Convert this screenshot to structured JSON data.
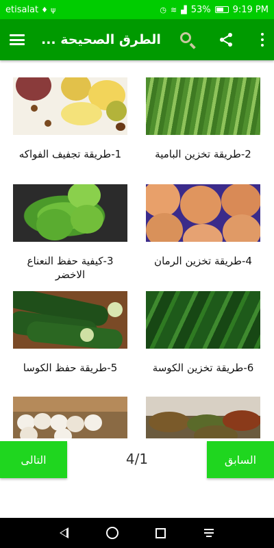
{
  "status_bar": {
    "carrier": "etisalat",
    "battery": "53%",
    "time": "9:19 PM"
  },
  "app_bar": {
    "title": "الطرق الصحيحة ...",
    "icons": [
      "menu-icon",
      "search-icon",
      "share-icon",
      "more-vert-icon"
    ]
  },
  "items": [
    {
      "caption": "2-طريقة تخزين البامية",
      "image": "okra"
    },
    {
      "caption": "1-طريقة تجفيف الفواكه",
      "image": "dried-fruit"
    },
    {
      "caption": "4-طريقة تخزين الرمان",
      "image": "pomegranate"
    },
    {
      "caption": "3-كيفية حفظ النعناع الاخضر",
      "image": "mint"
    },
    {
      "caption": "6-طريقة تخزين الكوسة",
      "image": "zucchini"
    },
    {
      "caption": "5-طريقة حفظ الكوسا",
      "image": "zucchini"
    },
    {
      "caption": "",
      "image": "spices"
    },
    {
      "caption": "",
      "image": "garlic"
    }
  ],
  "pager": {
    "next_label": "التالى",
    "prev_label": "السابق",
    "page_indicator": "4/1"
  },
  "colors": {
    "status_bar": "#00cc00",
    "app_bar": "#009a00",
    "pager_button": "#1fd61f"
  }
}
